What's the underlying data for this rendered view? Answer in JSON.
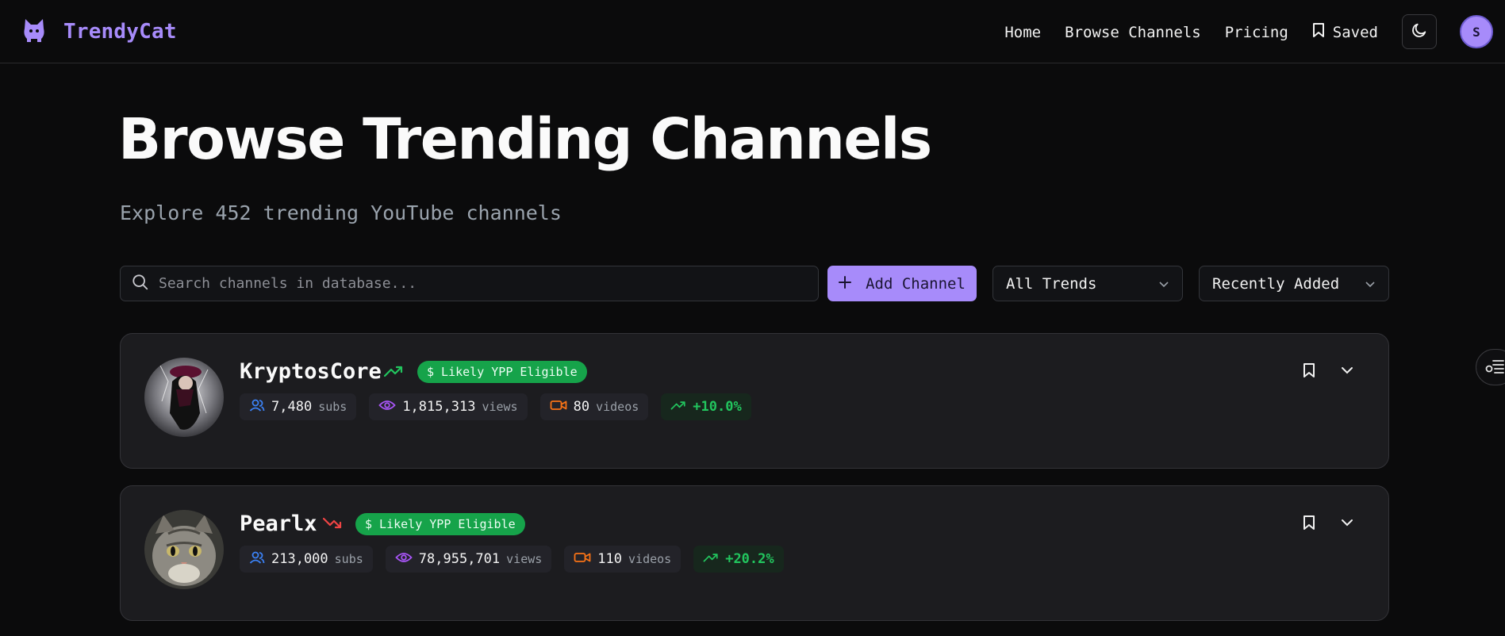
{
  "brand": {
    "name": "TrendyCat"
  },
  "nav": {
    "links": [
      "Home",
      "Browse Channels",
      "Pricing"
    ],
    "saved_label": "Saved",
    "avatar_initial": "S"
  },
  "page": {
    "title": "Browse Trending Channels",
    "subtitle": "Explore 452 trending YouTube channels"
  },
  "toolbar": {
    "search_placeholder": "Search channels in database...",
    "add_button": "Add Channel",
    "trend_filter": "All Trends",
    "sort": "Recently Added"
  },
  "channels": [
    {
      "name": "KryptosCore",
      "trend": "up",
      "badge": "$ Likely YPP Eligible",
      "subs": "7,480",
      "subs_unit": "subs",
      "views": "1,815,313",
      "views_unit": "views",
      "videos": "80",
      "videos_unit": "videos",
      "growth": "+10.0%"
    },
    {
      "name": "Pearlx",
      "trend": "down",
      "badge": "$ Likely YPP Eligible",
      "subs": "213,000",
      "subs_unit": "subs",
      "views": "78,955,701",
      "views_unit": "views",
      "videos": "110",
      "videos_unit": "videos",
      "growth": "+20.2%"
    }
  ],
  "colors": {
    "accent": "#a78bfa",
    "background": "#0b0b0c",
    "card": "#1c1c1f",
    "badge_green": "#16a34a",
    "growth_green": "#22c55e",
    "trend_down": "#ef4444"
  },
  "icons": [
    "cat-logo-icon",
    "bookmark-icon",
    "moon-icon",
    "search-icon",
    "plus-icon",
    "chevron-down-icon",
    "trending-up-icon",
    "trending-down-icon",
    "users-icon",
    "eye-icon",
    "video-icon",
    "filter-list-icon"
  ]
}
